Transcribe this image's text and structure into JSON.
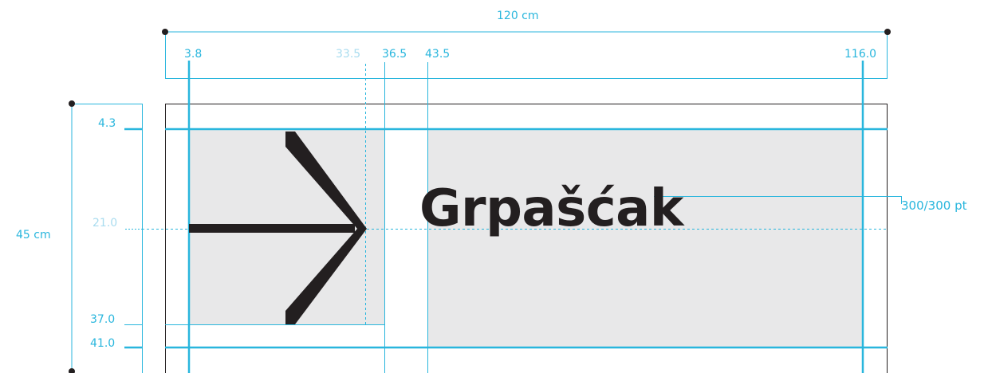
{
  "diagram": {
    "width_label": "120 cm",
    "height_label": "45 cm",
    "horizontal_marks": [
      "3.8",
      "33.5",
      "36.5",
      "43.5",
      "116.0"
    ],
    "vertical_marks": [
      "4.3",
      "21.0",
      "37.0",
      "41.0"
    ],
    "sign_text": "Grpašćak",
    "type_size_label": "300/300 pt",
    "arrow_icon": "right-arrow-icon",
    "colors": {
      "guide": "#29b6dd",
      "guide_light": "#a9dcef",
      "panel": "#e8e8e9",
      "ink": "#231f20"
    }
  }
}
